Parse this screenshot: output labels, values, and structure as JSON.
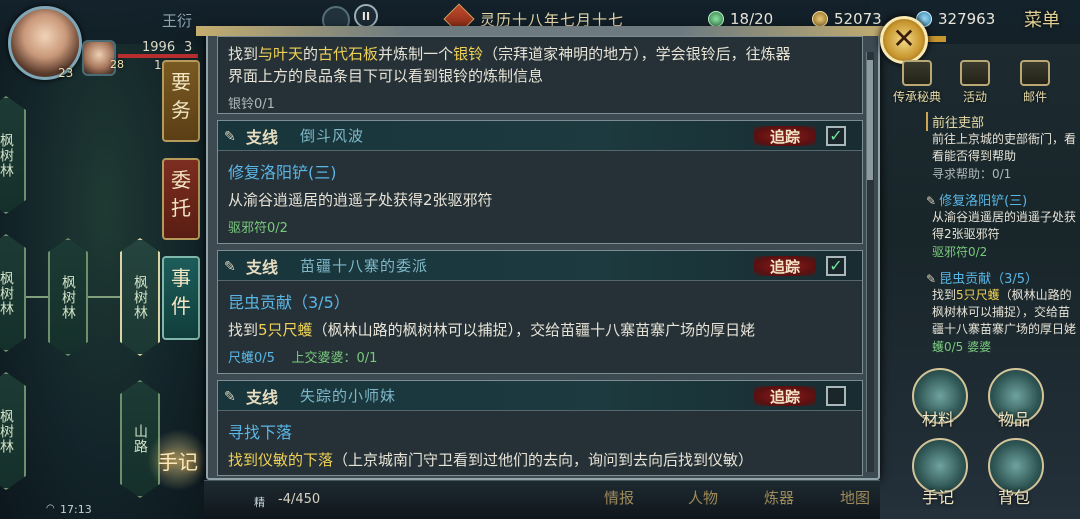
{
  "header": {
    "player_name": "王衍",
    "player_level": "23",
    "companion_level": "28",
    "hp_text": "1996",
    "hp_extra": "3",
    "mp_text": "1",
    "pause_label": "II",
    "date": "灵历十八年七月十七",
    "stamina": "18/20",
    "coins": "52073",
    "gems": "327963",
    "menu_label": "菜单",
    "close_label": "✕"
  },
  "side_tabs": {
    "important": "要务",
    "commission": "委托",
    "event": "事件",
    "notebook": "手记"
  },
  "map": {
    "nodes": [
      "枫树林",
      "枫树林",
      "枫树林",
      "枫树林",
      "枫树林",
      "山路"
    ]
  },
  "quests": [
    {
      "description_prefix": "找到",
      "description_highlight_1": "与叶天",
      "description_mid": "的",
      "description_highlight_2": "古代石板",
      "description_rest": "并炼制一个",
      "description_highlight_3": "银铃",
      "description_tail": "（宗拜道家神明的地方），学会银铃后，往炼器",
      "description_line2": "界面上方的良品条目下可以看到银铃的炼制信息",
      "progress": "银铃0/1"
    },
    {
      "type": "支线",
      "title": "倒斗风波",
      "track_label": "追踪",
      "checked": true,
      "name": "修复洛阳铲(三)",
      "description": "从渝谷逍遥居的逍遥子处获得2张驱邪符",
      "progress": "驱邪符0/2"
    },
    {
      "type": "支线",
      "title": "苗疆十八寨的委派",
      "track_label": "追踪",
      "checked": true,
      "name": "昆虫贡献（3/5）",
      "description_prefix": "找到",
      "description_highlight": "5只尺蠖",
      "description_rest": "（枫林山路的枫树林可以捕捉），交给苗疆十八寨苗寨广场的厚日姥",
      "progress_1": "尺蠖0/5",
      "progress_2": "上交婆婆：0/1"
    },
    {
      "type": "支线",
      "title": "失踪的小师妹",
      "track_label": "追踪",
      "checked": false,
      "name": "寻找下落",
      "description_highlight": "找到仪敏的下落",
      "description_rest": "（上京城南门守卫看到过他们的去向，询问到去向后找到仪敏）"
    }
  ],
  "right_top": {
    "items": [
      {
        "label": "传承秘典",
        "icon": "book-icon"
      },
      {
        "label": "活动",
        "icon": "gift-icon"
      },
      {
        "label": "邮件",
        "icon": "mail-icon"
      }
    ]
  },
  "tracked": [
    {
      "title": "前往吏部",
      "desc": "前往上京城的吏部衙门，看看能否得到帮助",
      "desc_highlight": "吏部衙门",
      "progress": "寻求帮助：0/1"
    },
    {
      "title": "修复洛阳铲(三)",
      "desc": "从渝谷逍遥居的逍遥子处获得2张驱邪符",
      "progress": "驱邪符0/2"
    },
    {
      "title": "昆虫贡献（3/5）",
      "desc_prefix": "找到",
      "desc_highlight": "5只尺蠖",
      "desc_rest": "（枫林山路的枫树林可以捕捉），交给苗疆十八寨苗寨广场的厚日姥",
      "progress": "蠖0/5",
      "progress_2": "婆婆"
    }
  ],
  "right_bottom": {
    "materials": "材料",
    "items": "物品",
    "notebook": "手记",
    "bag": "背包"
  },
  "bottom": {
    "value": "-4/450",
    "prefix": "精",
    "tabs": [
      "情报",
      "人物",
      "炼器",
      "地图"
    ],
    "time": "17:13"
  }
}
